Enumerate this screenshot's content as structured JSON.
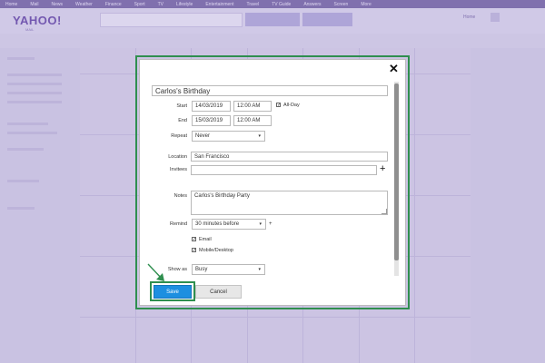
{
  "topbar": {
    "items": [
      "Home",
      "Mail",
      "News",
      "Weather",
      "Finance",
      "Sport",
      "TV",
      "Lifestyle",
      "Entertainment",
      "Travel",
      "TV Guide",
      "Answers",
      "Screen",
      "More"
    ]
  },
  "header": {
    "logo": "YAHOO!",
    "logo_sub": "MAIL",
    "right_home": "Home"
  },
  "dialog": {
    "title_value": "Carlos's Birthday",
    "start_label": "Start",
    "start_date": "14/03/2019",
    "start_time": "12:00 AM",
    "allday_label": "All-Day",
    "end_label": "End",
    "end_date": "15/03/2019",
    "end_time": "12:00 AM",
    "repeat_label": "Repeat",
    "repeat_value": "Never",
    "location_label": "Location",
    "location_value": "San Francisco",
    "invitees_label": "Invitees",
    "invitees_value": "",
    "notes_label": "Notes",
    "notes_value": "Carlos's Birthday Party",
    "remind_label": "Remind",
    "remind_value": "30 minutes before",
    "email_label": "Email",
    "mobile_label": "Mobile/Desktop",
    "showas_label": "Show as",
    "showas_value": "Busy",
    "save_label": "Save",
    "cancel_label": "Cancel",
    "close_glyph": "✕",
    "plus_glyph": "+",
    "check_glyph": "✓",
    "arrow_glyph": "▾"
  },
  "colors": {
    "accent": "#1d8fe0",
    "highlight": "#2f8f4f",
    "brand": "#6b5a9e"
  },
  "icons": {
    "close": "close-icon",
    "add_invitee": "plus-icon",
    "add_reminder": "plus-icon",
    "dropdown": "chevron-down-icon",
    "pointer": "arrow-icon"
  }
}
